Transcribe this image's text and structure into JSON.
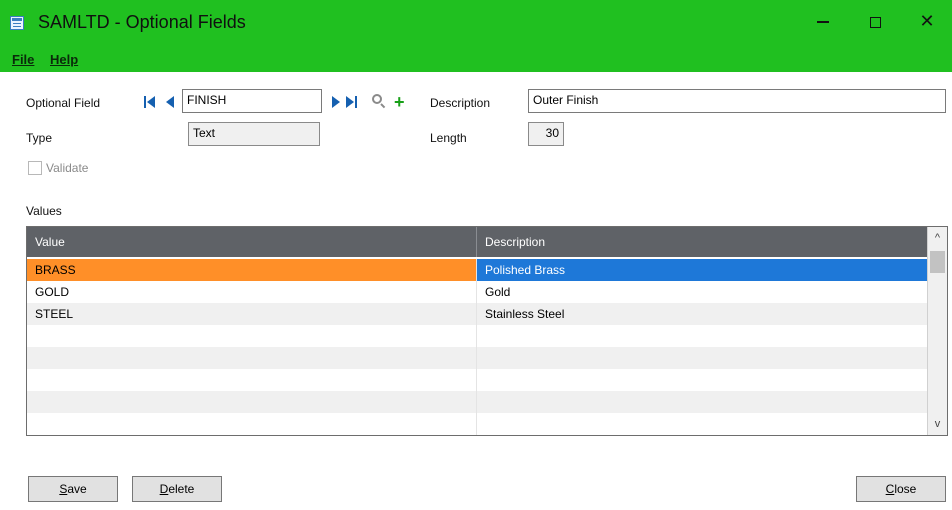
{
  "window": {
    "title": "SAMLTD - Optional Fields",
    "icon": "form-icon",
    "controls": {
      "minimize": "minimize-icon",
      "maximize": "maximize-icon",
      "close": "close-icon"
    }
  },
  "menu": {
    "file": {
      "label": "File"
    },
    "help": {
      "label": "Help"
    }
  },
  "form": {
    "optional_field": {
      "label": "Optional Field",
      "value": "FINISH"
    },
    "description": {
      "label": "Description",
      "value": "Outer Finish"
    },
    "type": {
      "label": "Type",
      "value": "Text"
    },
    "length": {
      "label": "Length",
      "value": "30"
    },
    "validate": {
      "label": "Validate",
      "checked": false,
      "enabled": false
    }
  },
  "values_section": {
    "label": "Values",
    "columns": [
      "Value",
      "Description"
    ],
    "rows": [
      {
        "value": "BRASS",
        "description": "Polished Brass",
        "selected": true
      },
      {
        "value": "GOLD",
        "description": "Gold",
        "selected": false
      },
      {
        "value": "STEEL",
        "description": "Stainless Steel",
        "selected": false
      }
    ]
  },
  "buttons": {
    "save": {
      "label_first": "S",
      "label_rest": "ave"
    },
    "delete": {
      "label_first": "D",
      "label_rest": "elete"
    },
    "close": {
      "label_first": "C",
      "label_rest": "lose"
    }
  },
  "colors": {
    "titlebar": "#20c020",
    "grid_header": "#5f6267",
    "selected_value_cell": "#ff8f28",
    "selected_desc_cell": "#1e78d8",
    "nav_arrows": "#1560b0",
    "add_icon": "#18a018"
  }
}
